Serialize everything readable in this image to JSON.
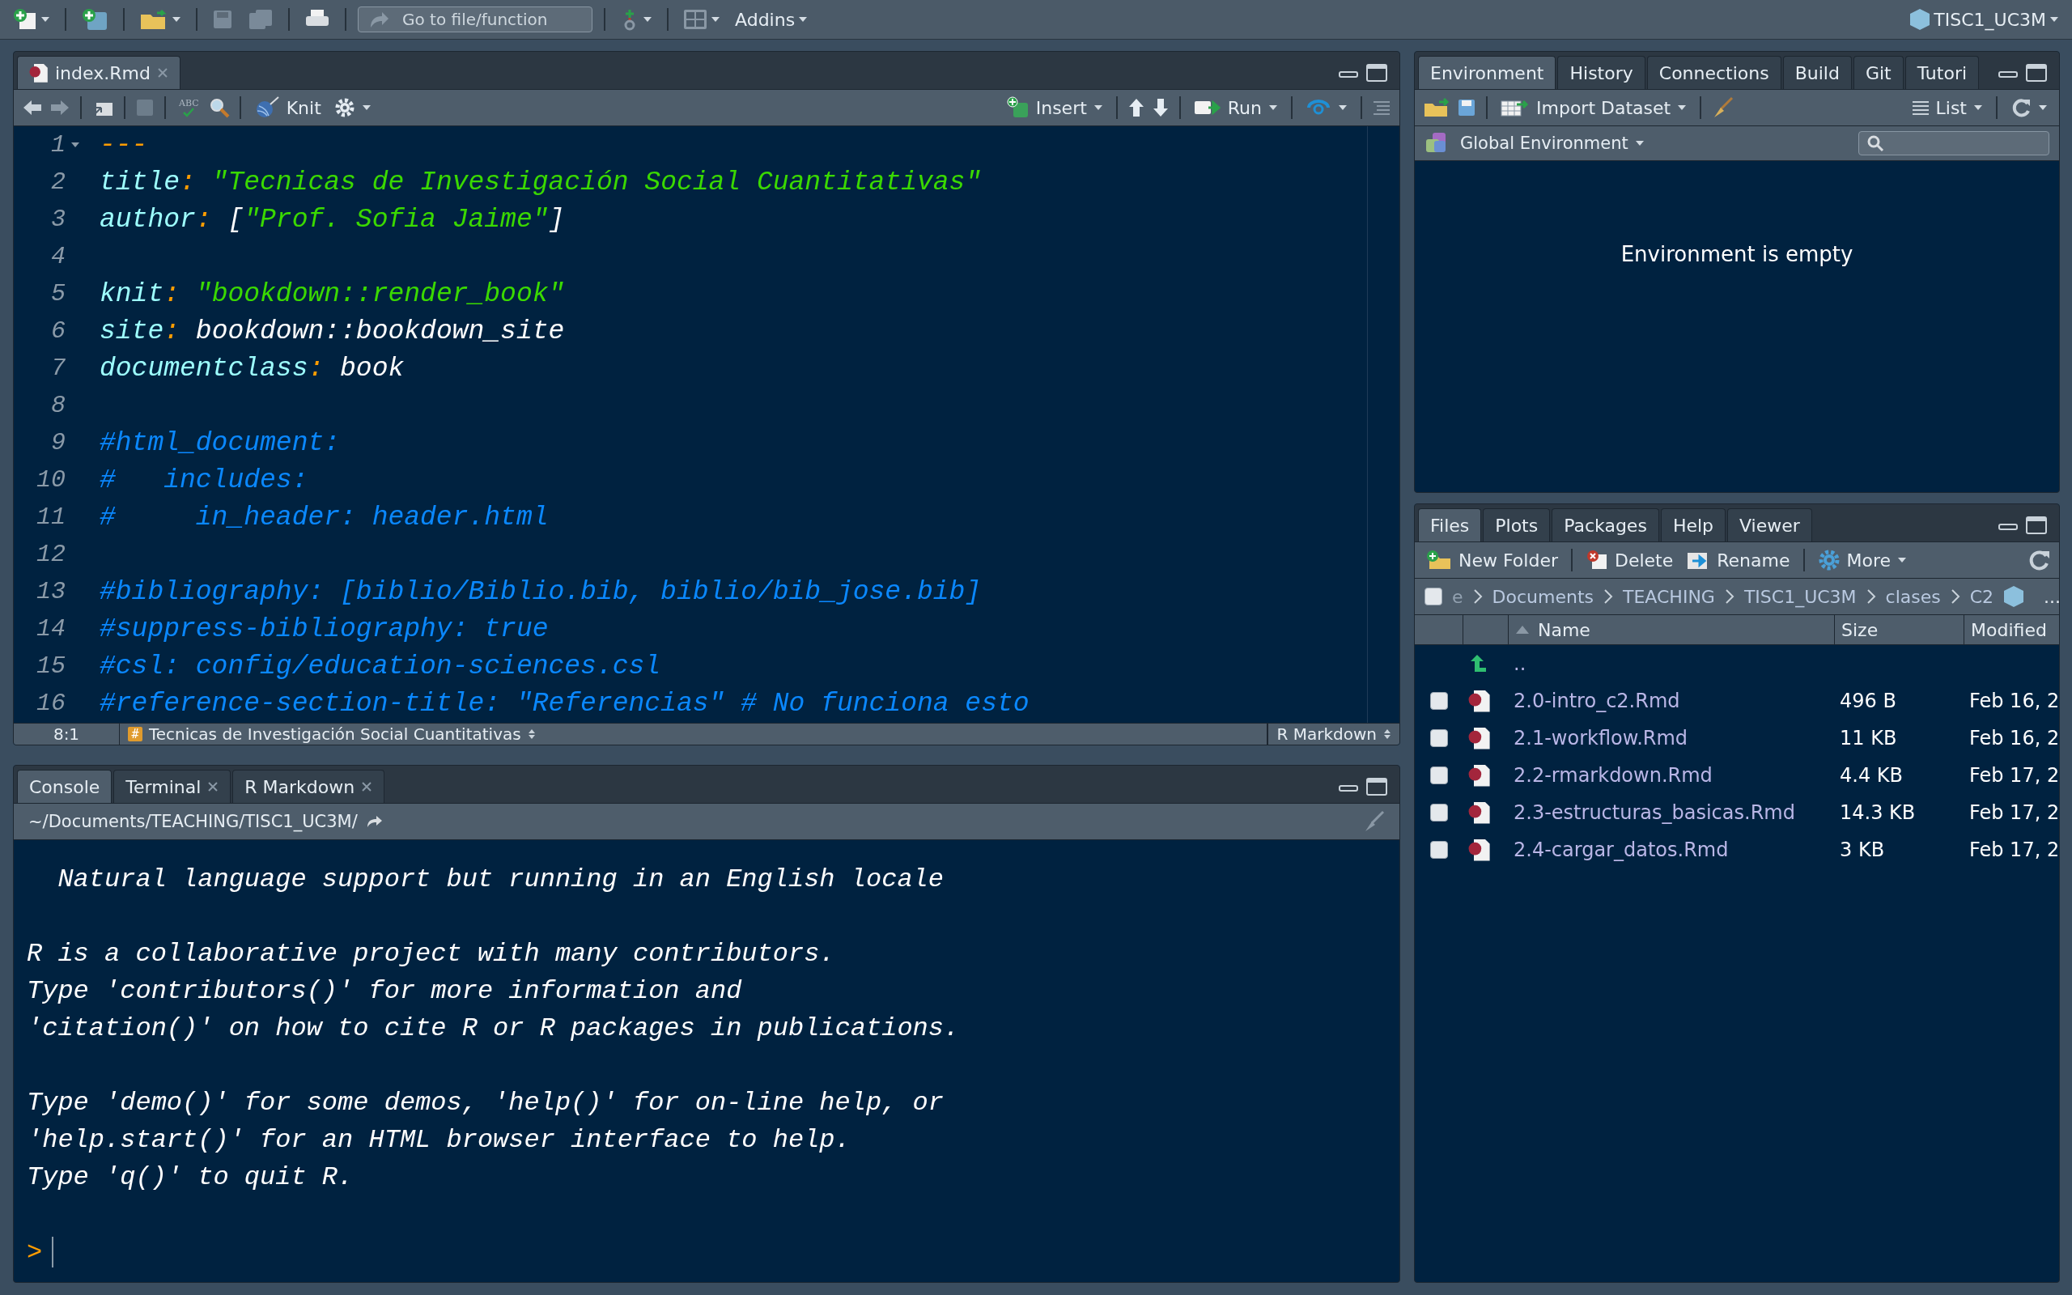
{
  "toolbar": {
    "goto_placeholder": "Go to file/function",
    "addins": "Addins",
    "project": "TISC1_UC3M"
  },
  "editor": {
    "tabs": [
      {
        "label": "index.Rmd",
        "selected": true,
        "closable": true
      }
    ],
    "toolbar": {
      "spellcheck": "ABC",
      "knit": "Knit",
      "insert": "Insert",
      "run": "Run"
    },
    "lines": [
      {
        "number": "1",
        "foldable": true,
        "tokens": [
          {
            "kind": "dash",
            "text": "---"
          }
        ]
      },
      {
        "number": "2",
        "foldable": false,
        "tokens": [
          {
            "kind": "key",
            "text": "title"
          },
          {
            "kind": "punct",
            "text": ": "
          },
          {
            "kind": "string",
            "text": "\"Tecnicas de Investigación Social Cuantitativas\""
          }
        ]
      },
      {
        "number": "3",
        "foldable": false,
        "tokens": [
          {
            "kind": "key",
            "text": "author"
          },
          {
            "kind": "punct",
            "text": ": "
          },
          {
            "kind": "plain",
            "text": "["
          },
          {
            "kind": "string",
            "text": "\"Prof. Sofia Jaime\""
          },
          {
            "kind": "plain",
            "text": "]"
          }
        ]
      },
      {
        "number": "4",
        "foldable": false
      },
      {
        "number": "5",
        "foldable": false,
        "tokens": [
          {
            "kind": "key",
            "text": "knit"
          },
          {
            "kind": "punct",
            "text": ": "
          },
          {
            "kind": "string",
            "text": "\"bookdown::render_book\""
          }
        ]
      },
      {
        "number": "6",
        "foldable": false,
        "tokens": [
          {
            "kind": "key",
            "text": "site"
          },
          {
            "kind": "punct",
            "text": ": "
          },
          {
            "kind": "plain",
            "text": "bookdown::bookdown_site"
          }
        ]
      },
      {
        "number": "7",
        "foldable": false,
        "tokens": [
          {
            "kind": "key",
            "text": "documentclass"
          },
          {
            "kind": "punct",
            "text": ": "
          },
          {
            "kind": "plain",
            "text": "book"
          }
        ]
      },
      {
        "number": "8",
        "foldable": false
      },
      {
        "number": "9",
        "foldable": false,
        "tokens": [
          {
            "kind": "comment",
            "text": "#html_document:"
          }
        ]
      },
      {
        "number": "10",
        "foldable": false,
        "tokens": [
          {
            "kind": "comment",
            "text": "#   includes:"
          }
        ]
      },
      {
        "number": "11",
        "foldable": false,
        "tokens": [
          {
            "kind": "comment",
            "text": "#     in_header: header.html"
          }
        ]
      },
      {
        "number": "12",
        "foldable": false
      },
      {
        "number": "13",
        "foldable": false,
        "tokens": [
          {
            "kind": "comment",
            "text": "#bibliography: [biblio/Biblio.bib, biblio/bib_jose.bib]"
          }
        ]
      },
      {
        "number": "14",
        "foldable": false,
        "tokens": [
          {
            "kind": "comment",
            "text": "#suppress-bibliography: true"
          }
        ]
      },
      {
        "number": "15",
        "foldable": false,
        "tokens": [
          {
            "kind": "comment",
            "text": "#csl: config/education-sciences.csl"
          }
        ]
      },
      {
        "number": "16",
        "foldable": false,
        "tokens": [
          {
            "kind": "comment",
            "text": "#reference-section-title: \"Referencias\" # No funciona esto"
          }
        ]
      }
    ],
    "status": {
      "position": "8:1",
      "section_marker": "#",
      "section": "Tecnicas de Investigación Social Cuantitativas",
      "mode": "R Markdown"
    }
  },
  "console": {
    "tabs": [
      {
        "label": "Console",
        "selected": true,
        "closable": false
      },
      {
        "label": "Terminal",
        "selected": false,
        "closable": true
      },
      {
        "label": "R Markdown",
        "selected": false,
        "closable": true
      }
    ],
    "path": "~/Documents/TEACHING/TISC1_UC3M/",
    "paragraphs": [
      [
        "  Natural language support but running in an English locale"
      ],
      [
        "R is a collaborative project with many contributors.",
        "Type 'contributors()' for more information and",
        "'citation()' on how to cite R or R packages in publications."
      ],
      [
        "Type 'demo()' for some demos, 'help()' for on-line help, or",
        "'help.start()' for an HTML browser interface to help.",
        "Type 'q()' to quit R."
      ]
    ],
    "prompt": ">"
  },
  "environment": {
    "tabs": [
      {
        "label": "Environment",
        "selected": true
      },
      {
        "label": "History",
        "selected": false
      },
      {
        "label": "Connections",
        "selected": false
      },
      {
        "label": "Build",
        "selected": false
      },
      {
        "label": "Git",
        "selected": false
      },
      {
        "label": "Tutori",
        "selected": false
      }
    ],
    "toolbar": {
      "import": "Import Dataset",
      "view": "List"
    },
    "scope": "Global Environment",
    "empty_message": "Environment is empty"
  },
  "files": {
    "tabs": [
      {
        "label": "Files",
        "selected": true
      },
      {
        "label": "Plots",
        "selected": false
      },
      {
        "label": "Packages",
        "selected": false
      },
      {
        "label": "Help",
        "selected": false
      },
      {
        "label": "Viewer",
        "selected": false
      }
    ],
    "toolbar": {
      "new_folder": "New Folder",
      "delete": "Delete",
      "rename": "Rename",
      "more": "More"
    },
    "select_all_checked": false,
    "breadcrumb": [
      "e",
      "Documents",
      "TEACHING",
      "TISC1_UC3M",
      "clases",
      "C2"
    ],
    "overflow": "...",
    "columns": [
      "Name",
      "Size",
      "Modified"
    ],
    "parent": "..",
    "rows": [
      {
        "name": "2.0-intro_c2.Rmd",
        "size": "496 B",
        "modified": "Feb 16, 2",
        "checked": false
      },
      {
        "name": "2.1-workflow.Rmd",
        "size": "11 KB",
        "modified": "Feb 16, 2",
        "checked": false
      },
      {
        "name": "2.2-rmarkdown.Rmd",
        "size": "4.4 KB",
        "modified": "Feb 17, 2",
        "checked": false
      },
      {
        "name": "2.3-estructuras_basicas.Rmd",
        "size": "14.3 KB",
        "modified": "Feb 17, 2",
        "checked": false
      },
      {
        "name": "2.4-cargar_datos.Rmd",
        "size": "3 KB",
        "modified": "Feb 17, 2",
        "checked": false
      }
    ]
  }
}
